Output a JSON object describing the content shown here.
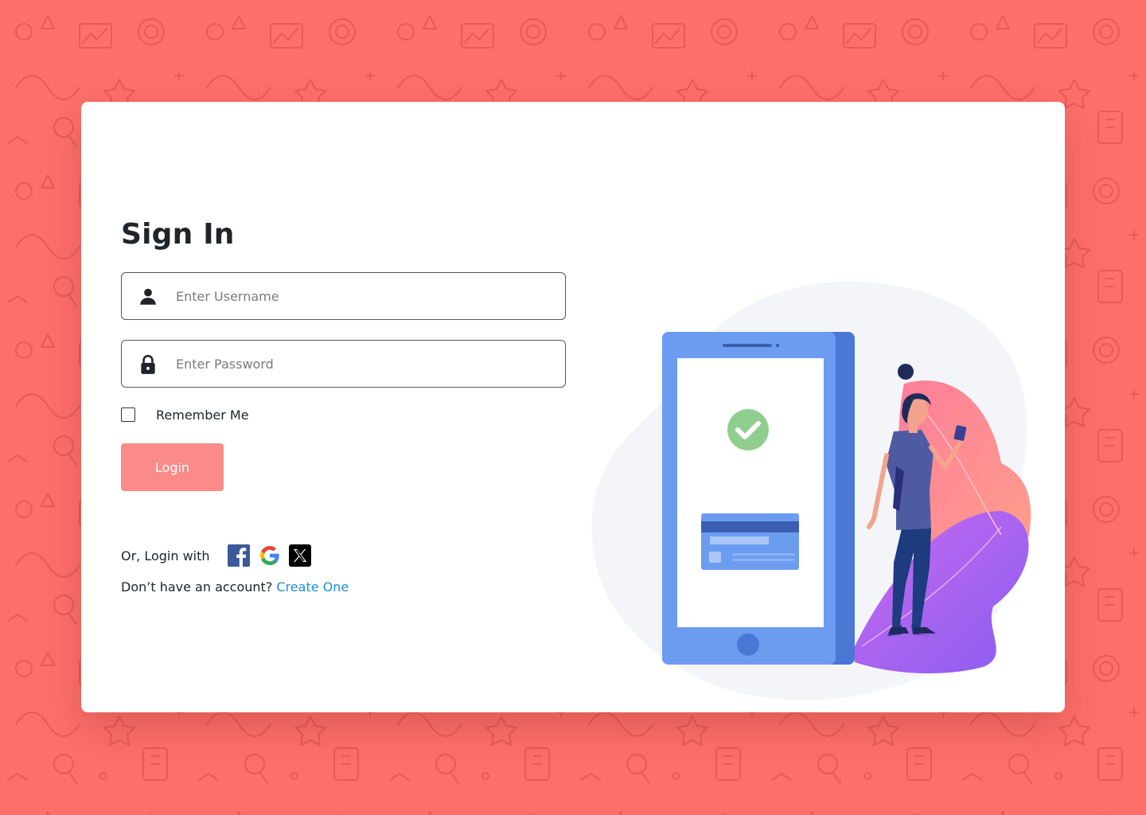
{
  "signin": {
    "title": "Sign In",
    "username_placeholder": "Enter Username",
    "password_placeholder": "Enter Password",
    "remember_label": "Remember Me",
    "remember_checked": false,
    "login_label": "Login",
    "social_label": "Or, Login with",
    "social_providers": [
      "facebook-icon",
      "google-icon",
      "x-icon"
    ],
    "no_account_text": "Don’t have an account?",
    "create_link": "Create One"
  },
  "icons": {
    "username": "user-icon",
    "password": "lock-icon"
  },
  "colors": {
    "background": "#ff6f6a",
    "login_button": "#fa8b89",
    "link": "#1a8fd1",
    "phone": "#6b9cf0",
    "checkmark": "#8fce8f"
  }
}
